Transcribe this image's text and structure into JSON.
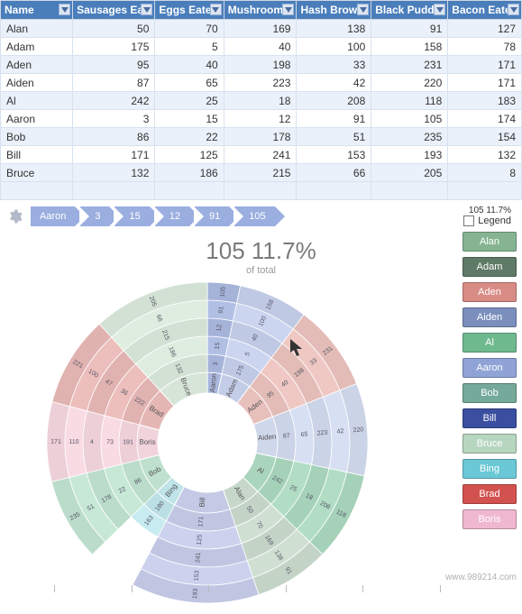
{
  "table": {
    "columns": [
      "Name",
      "Sausages Eaten",
      "Eggs Eaten",
      "Mushrooms",
      "Hash Brown",
      "Black Pudding",
      "Bacon Eaten"
    ],
    "rows": [
      {
        "name": "Alan",
        "v": [
          50,
          70,
          169,
          138,
          91,
          127
        ]
      },
      {
        "name": "Adam",
        "v": [
          175,
          5,
          40,
          100,
          158,
          78
        ]
      },
      {
        "name": "Aden",
        "v": [
          95,
          40,
          198,
          33,
          231,
          171
        ]
      },
      {
        "name": "Aiden",
        "v": [
          87,
          65,
          223,
          42,
          220,
          171
        ]
      },
      {
        "name": "Al",
        "v": [
          242,
          25,
          18,
          208,
          118,
          183
        ]
      },
      {
        "name": "Aaron",
        "v": [
          3,
          15,
          12,
          91,
          105,
          174
        ]
      },
      {
        "name": "Bob",
        "v": [
          86,
          22,
          178,
          51,
          235,
          154
        ]
      },
      {
        "name": "Bill",
        "v": [
          171,
          125,
          241,
          153,
          193,
          132
        ]
      },
      {
        "name": "Bruce",
        "v": [
          132,
          186,
          215,
          66,
          205,
          8
        ]
      }
    ]
  },
  "breadcrumb": {
    "items": [
      "Aaron",
      "3",
      "15",
      "12",
      "91",
      "105"
    ]
  },
  "legend_toggle": {
    "stat": "105 11.7%",
    "label": "Legend"
  },
  "center": {
    "big": "105 11.7%",
    "sub": "of total"
  },
  "legend": [
    {
      "label": "Alan",
      "color": "#86b493"
    },
    {
      "label": "Adam",
      "color": "#5f7a66"
    },
    {
      "label": "Aden",
      "color": "#d98b85"
    },
    {
      "label": "Aiden",
      "color": "#7b8fbd"
    },
    {
      "label": "Al",
      "color": "#6fb98f"
    },
    {
      "label": "Aaron",
      "color": "#8fa3d6"
    },
    {
      "label": "Bob",
      "color": "#75a99a"
    },
    {
      "label": "Bill",
      "color": "#3b4fa0"
    },
    {
      "label": "Bruce",
      "color": "#b7d6bf"
    },
    {
      "label": "Bing",
      "color": "#6bc8d6"
    },
    {
      "label": "Brad",
      "color": "#d2524f"
    },
    {
      "label": "Boris",
      "color": "#f0b7d0"
    }
  ],
  "watermark": "www.989214.com",
  "chart_data": {
    "type": "pie",
    "title": "105 11.7% of total",
    "series": [
      {
        "name": "Aaron",
        "values": [
          3,
          15,
          12,
          91,
          105
        ],
        "color": "#aab7dd",
        "labels": [
          "3",
          "15",
          "12",
          "91",
          "105"
        ]
      },
      {
        "name": "Adam",
        "values": [
          175,
          5,
          40,
          100,
          158
        ],
        "color": "#c3cde7",
        "labels": [
          "175",
          "5",
          "40",
          "100",
          "158"
        ]
      },
      {
        "name": "Aden",
        "values": [
          95,
          40,
          198,
          33,
          231
        ],
        "color": "#e7c0bb",
        "labels": [
          "95",
          "40",
          "198",
          "33",
          "231"
        ]
      },
      {
        "name": "Aiden",
        "values": [
          87,
          65,
          223,
          42,
          220
        ],
        "color": "#cfd7ea",
        "labels": [
          "87",
          "65",
          "223",
          "42",
          "220"
        ]
      },
      {
        "name": "Al",
        "values": [
          242,
          25,
          18,
          208,
          118
        ],
        "color": "#a9d5bc",
        "labels": [
          "242",
          "25",
          "18",
          "208",
          "118"
        ]
      },
      {
        "name": "Alan",
        "values": [
          50,
          70,
          169,
          138,
          91
        ],
        "color": "#c7d8cb",
        "labels": [
          "50",
          "70",
          "169",
          "138",
          "91"
        ]
      },
      {
        "name": "Bill",
        "values": [
          171,
          125,
          241,
          153,
          193
        ],
        "color": "#c4cae6",
        "labels": [
          "171",
          "125",
          "241",
          "153",
          "193"
        ]
      },
      {
        "name": "Bing",
        "values": [
          180,
          163
        ],
        "color": "#bfe3e8",
        "labels": [
          "180",
          "163"
        ]
      },
      {
        "name": "Bob",
        "values": [
          86,
          22,
          178,
          51,
          235
        ],
        "color": "#bfe0cf",
        "labels": [
          "86",
          "22",
          "178",
          "51",
          "235"
        ]
      },
      {
        "name": "Boris",
        "values": [
          191,
          73,
          4,
          110,
          171
        ],
        "color": "#f1d3dc",
        "labels": [
          "191",
          "73",
          "4",
          "110",
          "171"
        ]
      },
      {
        "name": "Brad",
        "values": [
          222,
          36,
          47,
          100,
          221
        ],
        "color": "#e4b6b4",
        "labels": [
          "222",
          "36",
          "47",
          "100",
          "221"
        ]
      },
      {
        "name": "Bruce",
        "values": [
          132,
          186,
          215,
          66,
          205
        ],
        "color": "#d7e5d8",
        "labels": [
          "132",
          "186",
          "215",
          "66",
          "205"
        ]
      }
    ]
  }
}
